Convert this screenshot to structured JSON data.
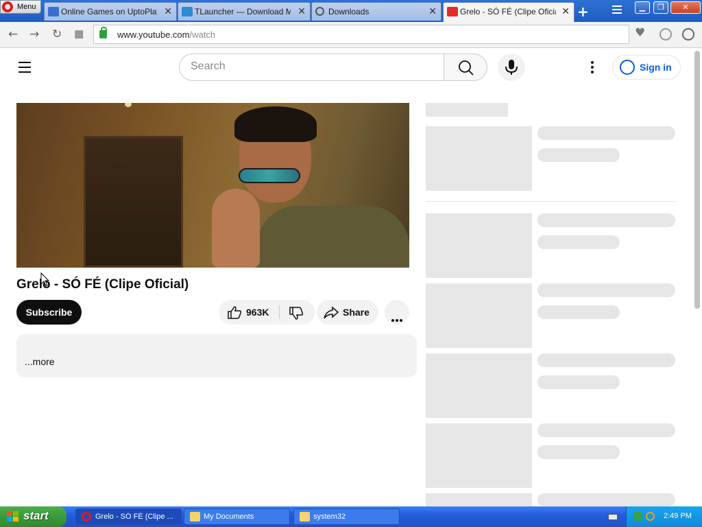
{
  "browser": {
    "menu_label": "Menu",
    "tabs": [
      {
        "title": "Online Games on UptoPlay —",
        "favicon": "uptoplay-icon"
      },
      {
        "title": "TLauncher — Download Mine",
        "favicon": "tlauncher-icon"
      },
      {
        "title": "Downloads",
        "favicon": "download-icon"
      },
      {
        "title": "Grelo - SÓ FÉ (Clipe Oficial) -",
        "favicon": "youtube-icon"
      }
    ],
    "url_host": "www.youtube.com",
    "url_path": "/watch"
  },
  "youtube": {
    "search_placeholder": "Search",
    "sign_in_label": "Sign in",
    "video_title": "Grelo - SÓ FÉ (Clipe Oficial)",
    "subscribe_label": "Subscribe",
    "like_count": "963K",
    "share_label": "Share",
    "description_more": "...more"
  },
  "taskbar": {
    "start_label": "start",
    "tasks": [
      {
        "title": "Grelo - SÓ FÉ (Clipe ...",
        "icon": "opera-icon"
      },
      {
        "title": "My Documents",
        "icon": "folder-icon"
      },
      {
        "title": "system32",
        "icon": "folder-icon"
      }
    ],
    "clock": "2:49 PM"
  },
  "colors": {
    "youtube_accent": "#065fd4",
    "xp_blue": "#245ddb",
    "xp_start_green": "#3a9a3a",
    "opera_red": "#e0181b"
  }
}
